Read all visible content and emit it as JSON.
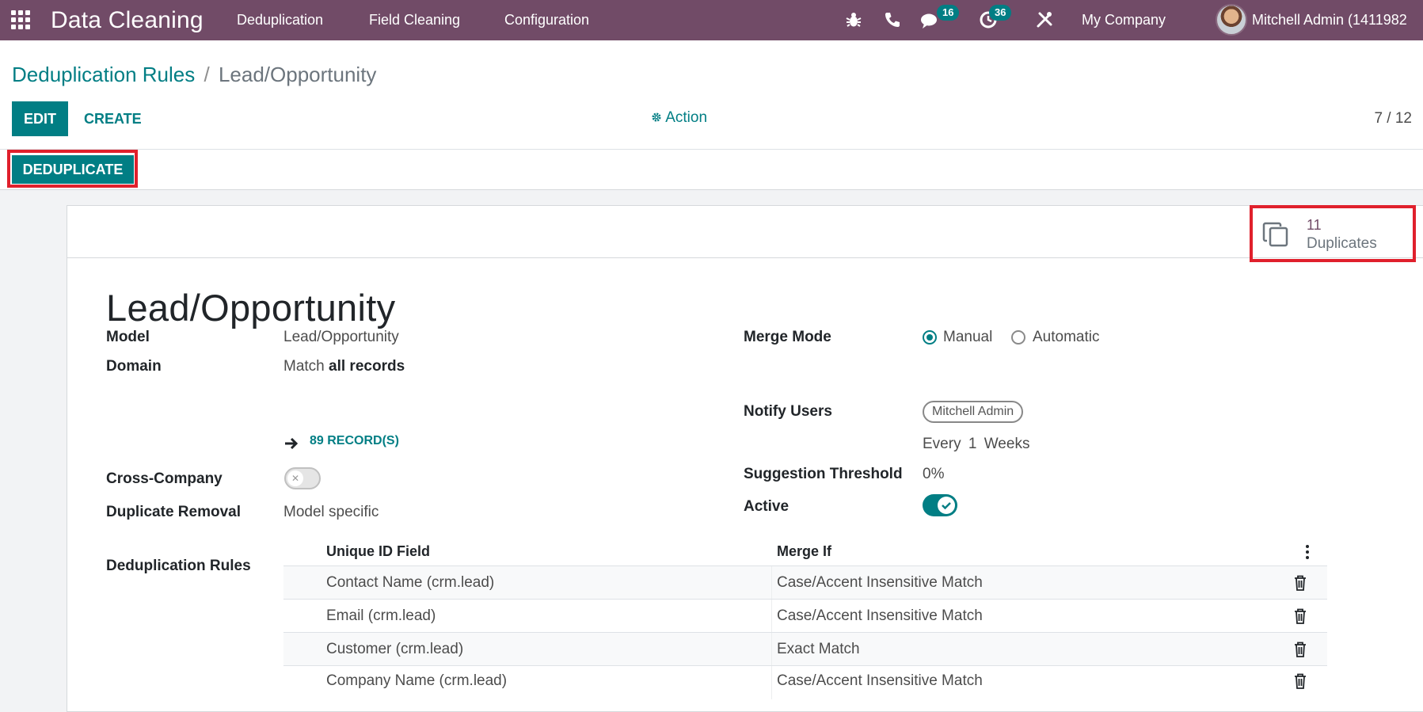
{
  "navbar": {
    "app_title": "Data Cleaning",
    "menus": [
      "Deduplication",
      "Field Cleaning",
      "Configuration"
    ],
    "messages_badge": "16",
    "activities_badge": "36",
    "company": "My Company",
    "user": "Mitchell Admin (1411982"
  },
  "breadcrumb": {
    "parent": "Deduplication Rules",
    "separator": "/",
    "current": "Lead/Opportunity"
  },
  "toolbar": {
    "edit_label": "EDIT",
    "create_label": "CREATE",
    "action_label": "Action",
    "pager": "7 / 12"
  },
  "statusbar": {
    "deduplicate_label": "DEDUPLICATE"
  },
  "stat_button": {
    "value": "11",
    "label": "Duplicates"
  },
  "form": {
    "title": "Lead/Opportunity",
    "model_label": "Model",
    "model_value": "Lead/Opportunity",
    "domain_label": "Domain",
    "domain_prefix": "Match",
    "domain_value": "all records",
    "records_link": "89 RECORD(S)",
    "cross_company_label": "Cross-Company",
    "cross_company_on": false,
    "duplicate_removal_label": "Duplicate Removal",
    "duplicate_removal_value": "Model specific",
    "merge_mode_label": "Merge Mode",
    "merge_mode_options": [
      "Manual",
      "Automatic"
    ],
    "merge_mode_selected": "Manual",
    "notify_users_label": "Notify Users",
    "notify_user_tag": "Mitchell Admin",
    "notify_every": "Every",
    "notify_interval": "1",
    "notify_unit": "Weeks",
    "suggestion_threshold_label": "Suggestion Threshold",
    "suggestion_threshold_value": "0%",
    "active_label": "Active",
    "active_on": true,
    "rules_label": "Deduplication Rules"
  },
  "rules_table": {
    "headers": [
      "Unique ID Field",
      "Merge If"
    ],
    "rows": [
      {
        "field": "Contact Name (crm.lead)",
        "merge_if": "Case/Accent Insensitive Match"
      },
      {
        "field": "Email (crm.lead)",
        "merge_if": "Case/Accent Insensitive Match"
      },
      {
        "field": "Customer (crm.lead)",
        "merge_if": "Exact Match"
      },
      {
        "field": "Company Name (crm.lead)",
        "merge_if": "Case/Accent Insensitive Match"
      }
    ]
  },
  "colors": {
    "brand": "#714b67",
    "accent": "#017e84",
    "highlight": "#e0202c"
  }
}
